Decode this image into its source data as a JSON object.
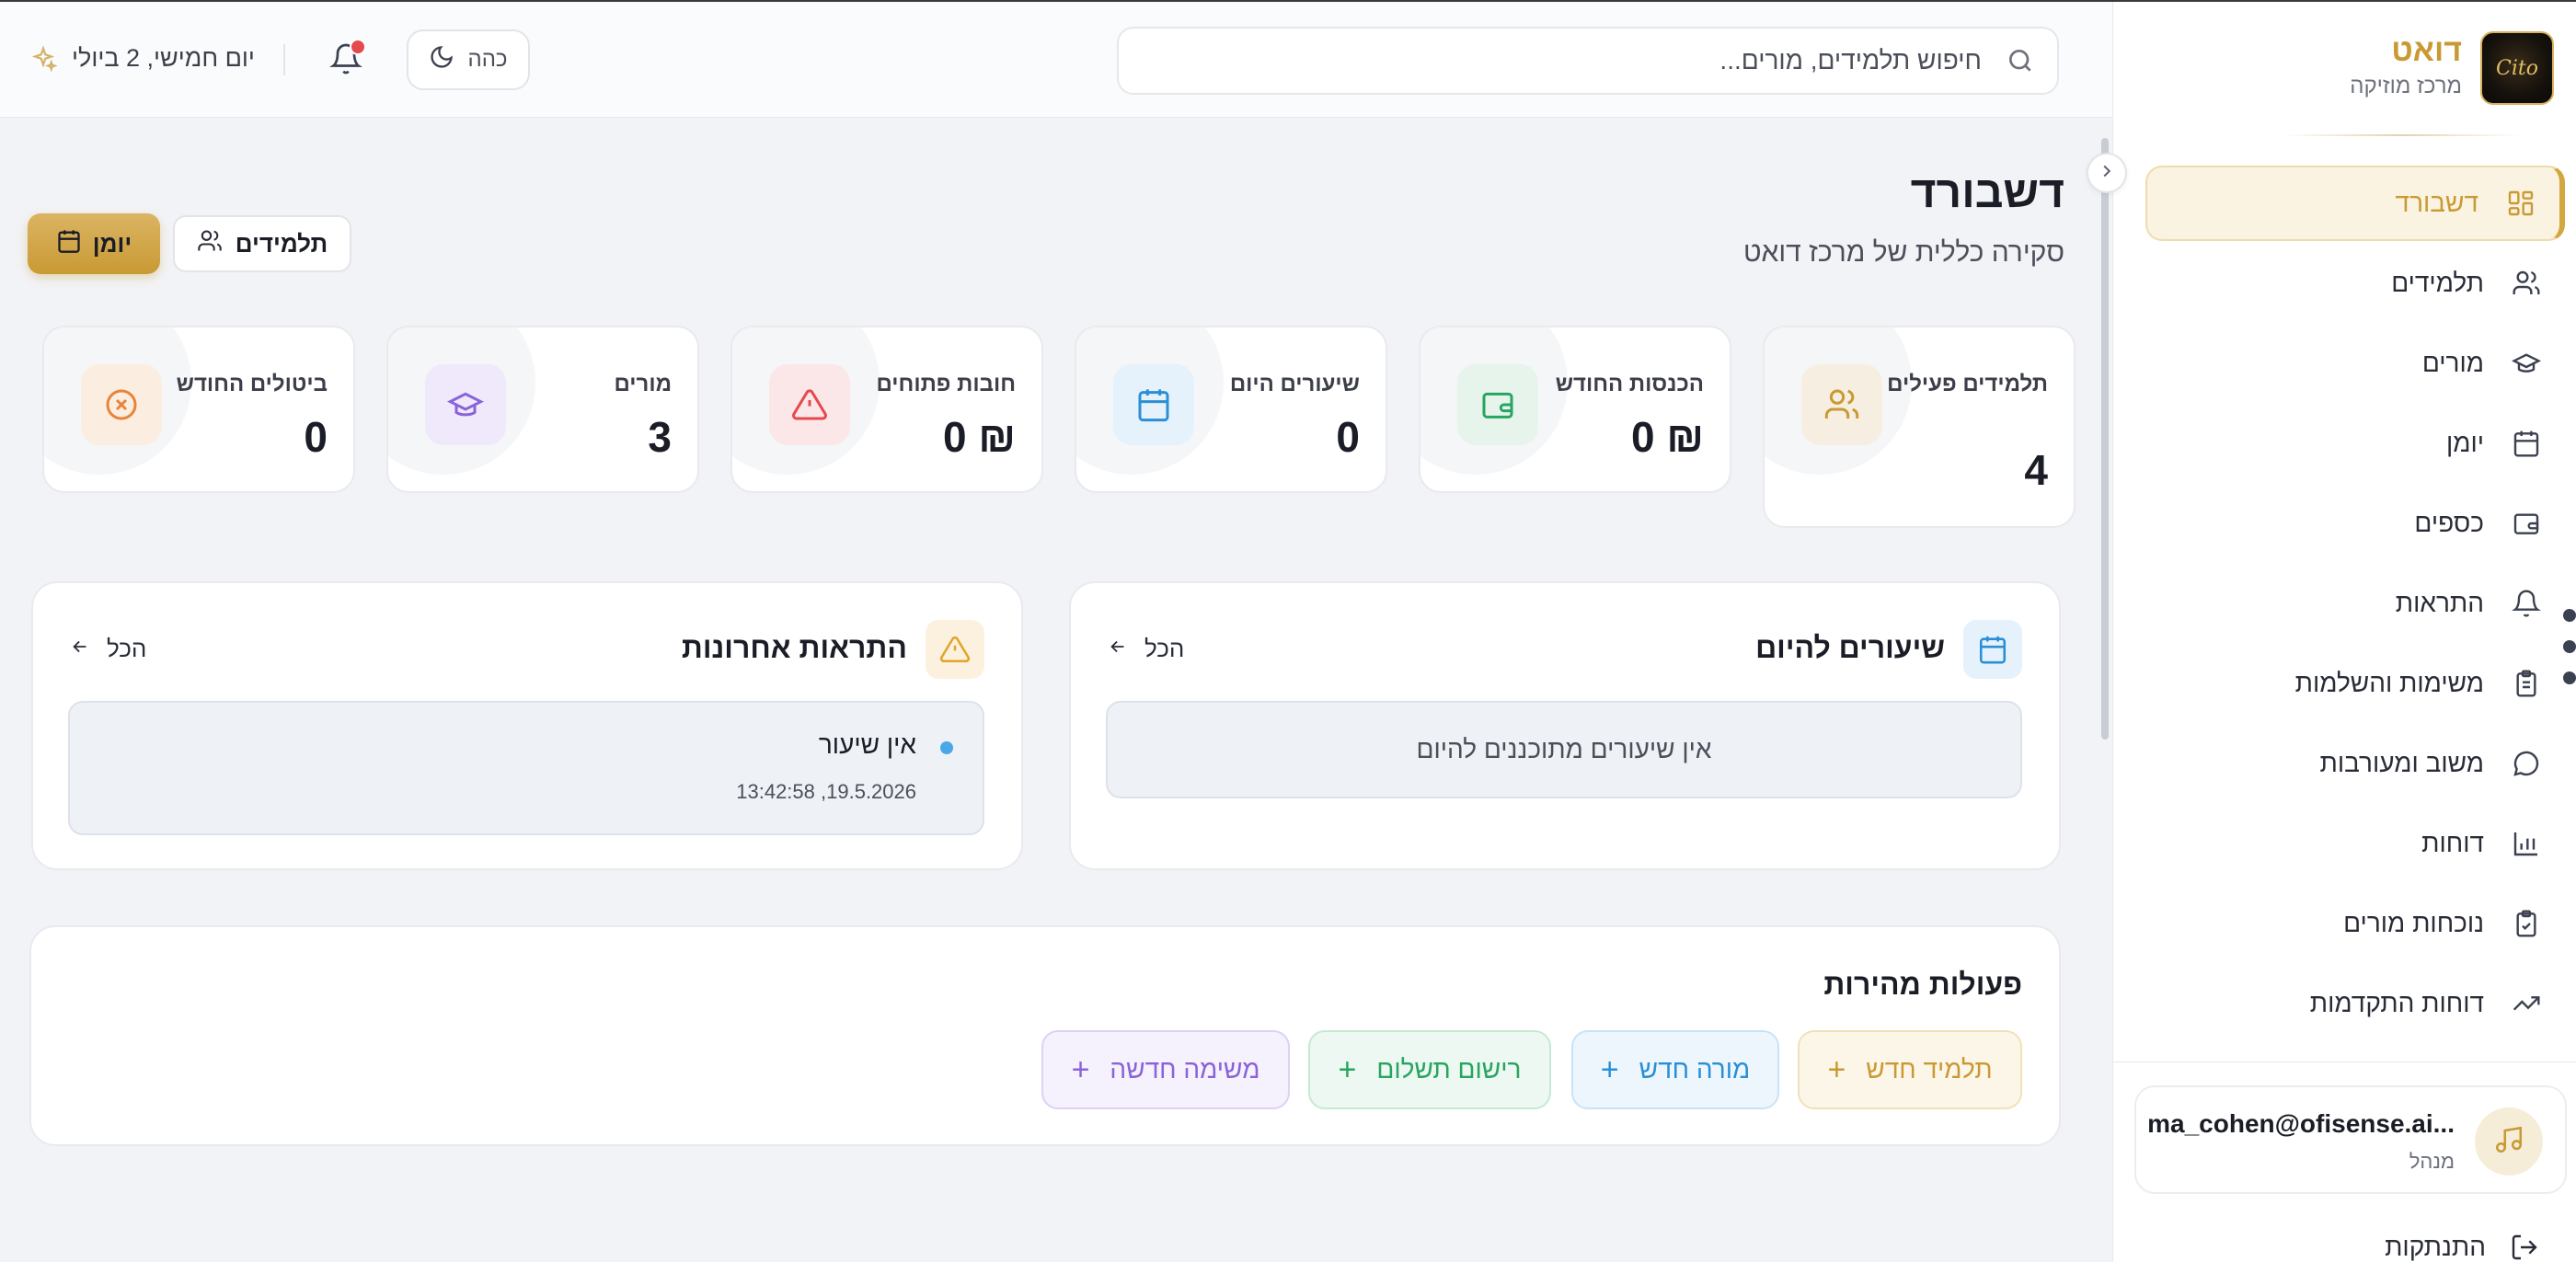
{
  "app": {
    "name": "דואט",
    "subtitle": "מרכז מוזיקה",
    "logo_text": "Cito"
  },
  "colors": {
    "brand_gold": "#c99a34",
    "active_bg": "#fbf3e1",
    "danger": "#e5484d",
    "info": "#4aa8e6"
  },
  "sidebar": {
    "items": [
      {
        "label": "דשבורד",
        "icon": "dashboard-grid-icon",
        "active": true
      },
      {
        "label": "תלמידים",
        "icon": "users-icon",
        "active": false
      },
      {
        "label": "מורים",
        "icon": "graduation-cap-icon",
        "active": false
      },
      {
        "label": "יומן",
        "icon": "calendar-icon",
        "active": false
      },
      {
        "label": "כספים",
        "icon": "wallet-icon",
        "active": false
      },
      {
        "label": "התראות",
        "icon": "bell-icon",
        "active": false
      },
      {
        "label": "משימות והשלמות",
        "icon": "clipboard-list-icon",
        "active": false
      },
      {
        "label": "משוב ומעורבות",
        "icon": "chat-bubble-icon",
        "active": false
      },
      {
        "label": "דוחות",
        "icon": "bar-chart-icon",
        "active": false
      },
      {
        "label": "נוכחות מורים",
        "icon": "clipboard-check-icon",
        "active": false
      },
      {
        "label": "דוחות התקדמות",
        "icon": "trending-up-icon",
        "active": false
      }
    ],
    "user": {
      "email": "ma_cohen@ofisense.ai...",
      "role": "מנהל",
      "avatar_icon": "music-note-icon"
    },
    "logout_label": "התנתקות"
  },
  "header": {
    "search_placeholder": "חיפוש תלמידים, מורים...",
    "theme_label": "כהה",
    "date_label": "יום חמישי, 2 ביולי"
  },
  "page": {
    "title": "דשבורד",
    "subtitle": "סקירה כללית של מרכז דואט",
    "diary_button": "יומן",
    "students_button": "תלמידים"
  },
  "stats": [
    {
      "label": "תלמידים פעילים",
      "value": "4",
      "icon": "users-icon",
      "color": "#c99a34",
      "bg": "#f6efe1"
    },
    {
      "label": "הכנסות החודש",
      "value": "₪ 0",
      "icon": "wallet-icon",
      "color": "#27a561",
      "bg": "#e6f4ec"
    },
    {
      "label": "שיעורים היום",
      "value": "0",
      "icon": "calendar-icon",
      "color": "#2a8fd6",
      "bg": "#e5f1fb"
    },
    {
      "label": "חובות פתוחים",
      "value": "₪ 0",
      "icon": "alert-triangle-icon",
      "color": "#e5484d",
      "bg": "#fbe7e8"
    },
    {
      "label": "מורים",
      "value": "3",
      "icon": "graduation-cap-icon",
      "color": "#8a63d8",
      "bg": "#efe9fb"
    },
    {
      "label": "ביטולים החודש",
      "value": "0",
      "icon": "x-circle-icon",
      "color": "#e8843a",
      "bg": "#fcede1"
    }
  ],
  "lessons_panel": {
    "title": "שיעורים להיום",
    "all_label": "הכל",
    "empty_text": "אין שיעורים מתוכננים להיום"
  },
  "alerts_panel": {
    "title": "התראות אחרונות",
    "all_label": "הכל",
    "items": [
      {
        "title": "אין שיעור",
        "time": "19.5.2026, 13:42:58"
      }
    ]
  },
  "quick_actions": {
    "title": "פעולות מהירות",
    "buttons": [
      {
        "label": "תלמיד חדש"
      },
      {
        "label": "מורה חדש"
      },
      {
        "label": "רישום תשלום"
      },
      {
        "label": "משימה חדשה"
      }
    ]
  }
}
